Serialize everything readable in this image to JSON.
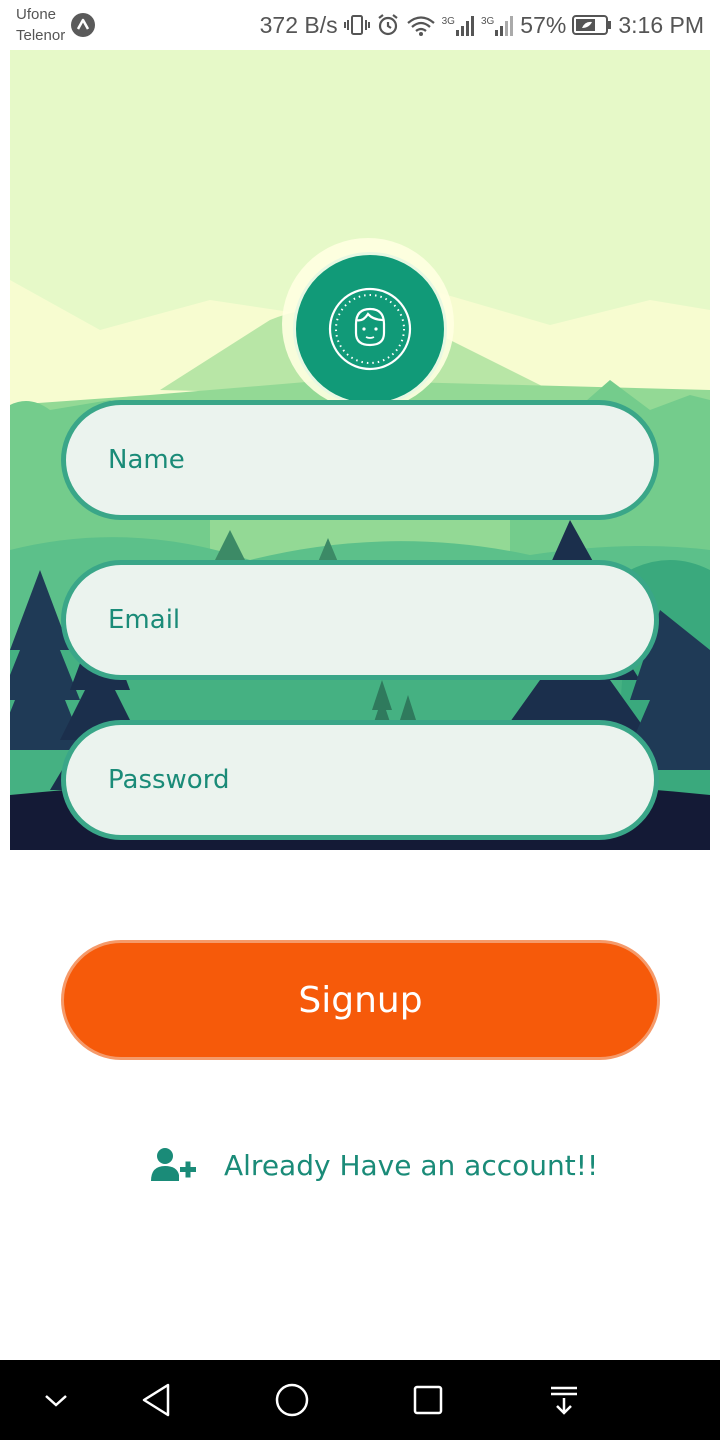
{
  "status_bar": {
    "carrier_1": "Ufone",
    "carrier_2": "Telenor",
    "network_speed": "372 B/s",
    "network_type_1": "3G",
    "network_type_2": "3G",
    "battery": "57%",
    "time": "3:16 PM"
  },
  "form": {
    "name_placeholder": "Name",
    "email_placeholder": "Email",
    "password_placeholder": "Password",
    "signup_label": "Signup",
    "login_link_label": "Already Have an account!!"
  },
  "colors": {
    "accent": "#119a78",
    "field_border": "#3aa688",
    "button": "#f65a0a",
    "link_text": "#1a8b78"
  },
  "icons": {
    "avatar": "user-face-icon",
    "login_link": "add-user-icon",
    "nav": [
      "chevron-down-icon",
      "back-icon",
      "home-icon",
      "recents-icon",
      "notifications-icon"
    ]
  }
}
